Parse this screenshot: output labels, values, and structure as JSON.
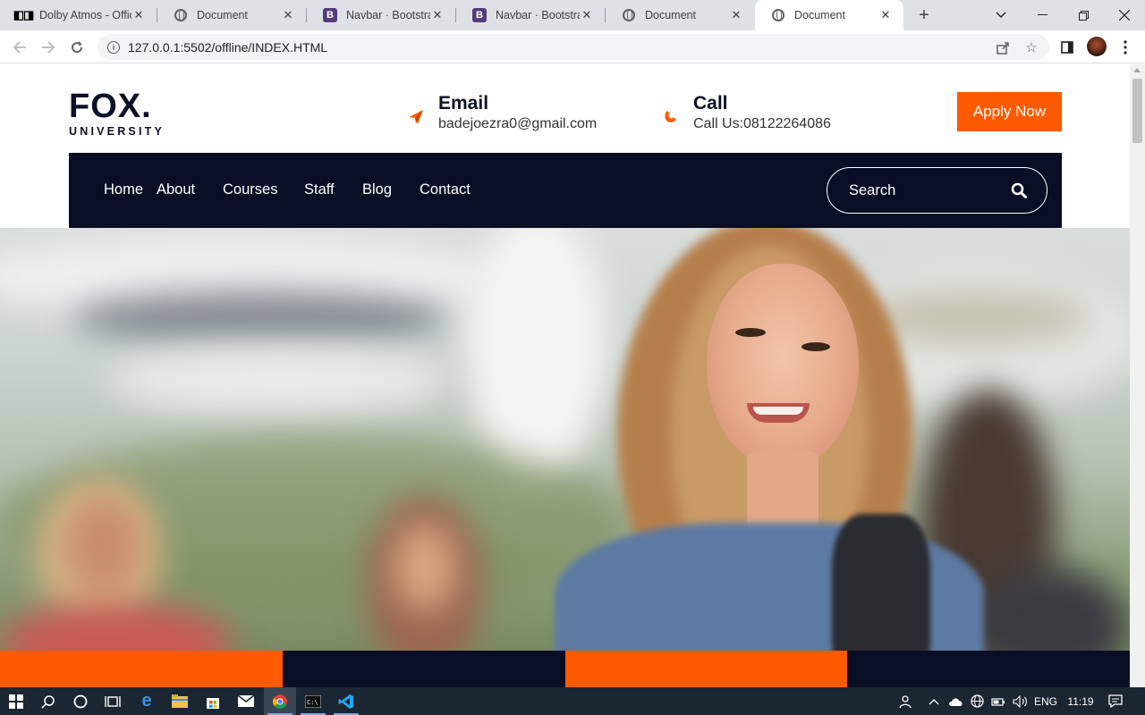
{
  "browser": {
    "tabs": [
      {
        "title": "Dolby Atmos - Offic",
        "icon": "dolby-icon",
        "active": false
      },
      {
        "title": "Document",
        "icon": "globe-icon",
        "active": false
      },
      {
        "title": "Navbar · Bootstrap",
        "icon": "bootstrap-icon",
        "active": false
      },
      {
        "title": "Navbar · Bootstrap",
        "icon": "bootstrap-icon",
        "active": false
      },
      {
        "title": "Document",
        "icon": "globe-icon",
        "active": false
      },
      {
        "title": "Document",
        "icon": "globe-icon",
        "active": true
      }
    ],
    "url": "127.0.0.1:5502/offline/INDEX.HTML"
  },
  "site": {
    "logo": {
      "main": "FOX.",
      "sub": "UNIVERSITY"
    },
    "email": {
      "title": "Email",
      "value": "badejoezra0@gmail.com",
      "icon": "paper-plane-icon"
    },
    "call": {
      "title": "Call",
      "value": "Call Us:08122264086",
      "icon": "phone-icon"
    },
    "apply_label": "Apply Now",
    "nav": [
      "Home",
      "About",
      "Courses",
      "Staff",
      "Blog",
      "Contact"
    ],
    "search_placeholder": "Search",
    "colors": {
      "accent": "#ff5a00",
      "navy": "#0a0e24"
    },
    "bottom_stripes": [
      "#ff5a00",
      "#0a0e24",
      "#ff5a00",
      "#0a0e24"
    ]
  },
  "taskbar": {
    "language": "ENG",
    "time": "11:19"
  }
}
